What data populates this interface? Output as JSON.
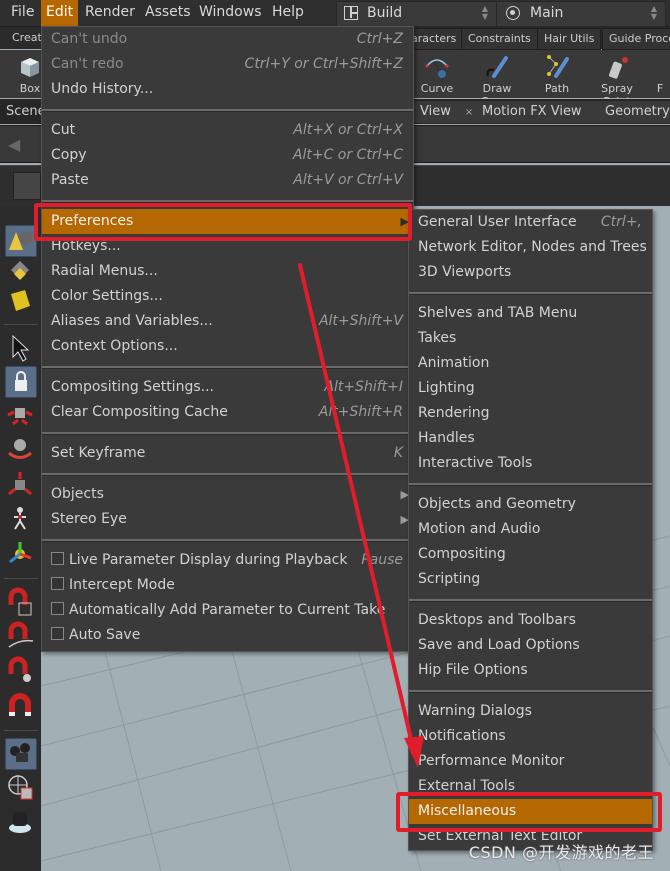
{
  "menubar": {
    "items": [
      "File",
      "Edit",
      "Render",
      "Assets",
      "Windows",
      "Help"
    ],
    "active": "Edit",
    "desktop_combo": "Build",
    "context_combo": "Main"
  },
  "shelf": {
    "tabs": [
      "Create",
      "aracters",
      "Constraints",
      "Hair Utils",
      "Guide Proce"
    ],
    "tools": [
      "Box",
      "Curve",
      "Draw Curve",
      "Path",
      "Spray Paint",
      "F"
    ]
  },
  "panes": {
    "tabs": [
      "Scene",
      "View",
      "Motion FX View",
      "Geometry S"
    ],
    "close_glyph": "×"
  },
  "edit_menu": {
    "groups": [
      [
        {
          "label": "Can't undo",
          "shortcut": "Ctrl+Z",
          "disabled": true
        },
        {
          "label": "Can't redo",
          "shortcut": "Ctrl+Y or Ctrl+Shift+Z",
          "disabled": true
        },
        {
          "label": "Undo History...",
          "shortcut": ""
        }
      ],
      [
        {
          "label": "Cut",
          "shortcut": "Alt+X or Ctrl+X"
        },
        {
          "label": "Copy",
          "shortcut": "Alt+C or Ctrl+C"
        },
        {
          "label": "Paste",
          "shortcut": "Alt+V or Ctrl+V"
        }
      ],
      [
        {
          "label": "Preferences",
          "submenu": true,
          "highlighted": true
        },
        {
          "label": "Hotkeys..."
        },
        {
          "label": "Radial Menus..."
        },
        {
          "label": "Color Settings..."
        },
        {
          "label": "Aliases and Variables...",
          "shortcut": "Alt+Shift+V"
        },
        {
          "label": "Context Options..."
        }
      ],
      [
        {
          "label": "Compositing Settings...",
          "shortcut": "Alt+Shift+I"
        },
        {
          "label": "Clear Compositing Cache",
          "shortcut": "Alt+Shift+R"
        }
      ],
      [
        {
          "label": "Set Keyframe",
          "shortcut": "K"
        }
      ],
      [
        {
          "label": "Objects",
          "submenu": true
        },
        {
          "label": "Stereo Eye",
          "submenu": true
        }
      ],
      [
        {
          "label": "Live Parameter Display during Playback",
          "shortcut": "Pause",
          "checkbox": false
        },
        {
          "label": "Intercept Mode",
          "checkbox": false
        },
        {
          "label": "Automatically Add Parameter to Current Take",
          "checkbox": false
        },
        {
          "label": "Auto Save",
          "checkbox": false
        }
      ]
    ]
  },
  "preferences_menu": {
    "groups": [
      [
        {
          "label": "General User Interface",
          "shortcut": "Ctrl+,"
        },
        {
          "label": "Network Editor, Nodes and Trees"
        },
        {
          "label": "3D Viewports"
        }
      ],
      [
        {
          "label": "Shelves and TAB Menu"
        },
        {
          "label": "Takes"
        },
        {
          "label": "Animation"
        },
        {
          "label": "Lighting"
        },
        {
          "label": "Rendering"
        },
        {
          "label": "Handles"
        },
        {
          "label": "Interactive Tools"
        }
      ],
      [
        {
          "label": "Objects and Geometry"
        },
        {
          "label": "Motion and Audio"
        },
        {
          "label": "Compositing"
        },
        {
          "label": "Scripting"
        }
      ],
      [
        {
          "label": "Desktops and Toolbars"
        },
        {
          "label": "Save and Load Options"
        },
        {
          "label": "Hip File Options"
        }
      ],
      [
        {
          "label": "Warning Dialogs"
        },
        {
          "label": "Notifications"
        },
        {
          "label": "Performance Monitor"
        },
        {
          "label": "External Tools"
        },
        {
          "label": "Miscellaneous",
          "highlighted": true
        },
        {
          "label": "Set External Text Editor"
        }
      ]
    ]
  },
  "annotations": {
    "highlight_color": "#e11d2b",
    "arrow_from": "Preferences",
    "arrow_to": "Miscellaneous"
  },
  "watermark": "CSDN @开发游戏的老王",
  "colors": {
    "menu_highlight": "#b56700",
    "menu_bg": "#3a3a3a",
    "viewport_bg": "#a2afb5"
  }
}
